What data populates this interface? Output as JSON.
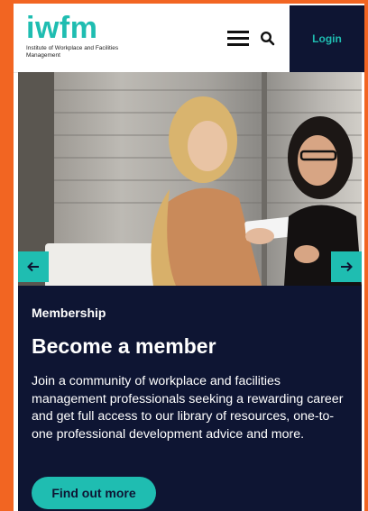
{
  "header": {
    "logo_text": "iwfm",
    "logo_subtitle": "Institute of Workplace and Facilities Management",
    "login_label": "Login"
  },
  "hero": {
    "image_desc": "photo of two women looking at a tablet in an office"
  },
  "content": {
    "eyebrow": "Membership",
    "title": "Become a member",
    "description": "Join a community of workplace and facilities management professionals seeking a rewarding career and get full access to our library of resources, one-to-one professional development advice and more.",
    "cta_label": "Find out more"
  },
  "colors": {
    "accent": "#1fbdb1",
    "navy": "#0e1533",
    "page_border": "#f26522"
  },
  "icons": {
    "menu": "hamburger-icon",
    "search": "search-icon",
    "prev": "arrow-left-icon",
    "next": "arrow-right-icon"
  }
}
